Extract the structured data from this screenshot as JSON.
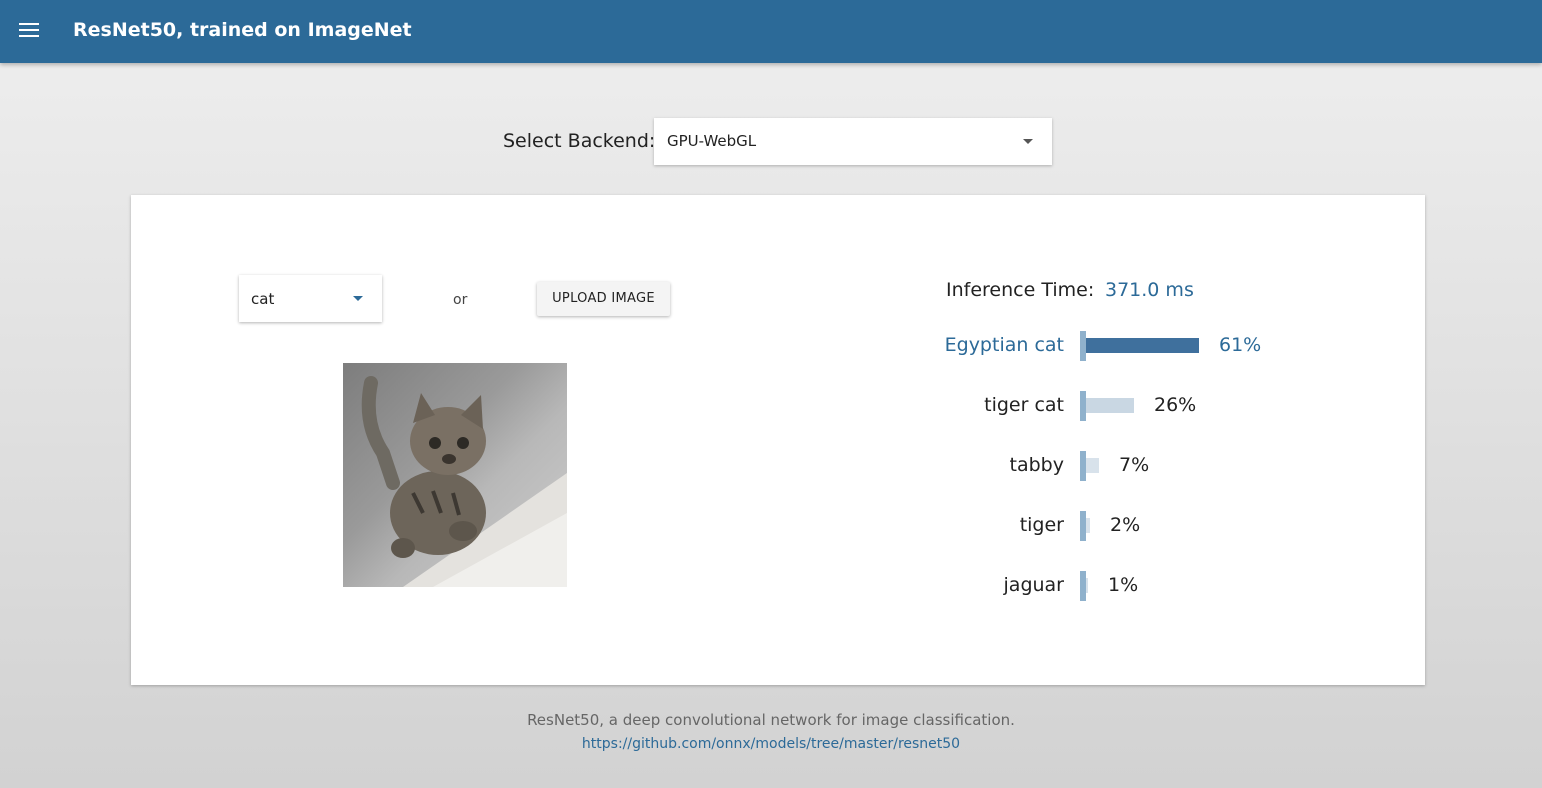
{
  "appbar": {
    "title": "ResNet50, trained on ImageNet"
  },
  "backend": {
    "label": "Select Backend:",
    "selected": "GPU-WebGL"
  },
  "input": {
    "image_select_value": "cat",
    "or_text": "or",
    "upload_label": "UPLOAD IMAGE"
  },
  "results": {
    "inference_label": "Inference Time:",
    "inference_value": "371.0 ms",
    "predictions": [
      {
        "label": "Egyptian cat",
        "percent": "61%",
        "value": 0.61
      },
      {
        "label": "tiger cat",
        "percent": "26%",
        "value": 0.26
      },
      {
        "label": "tabby",
        "percent": "7%",
        "value": 0.07
      },
      {
        "label": "tiger",
        "percent": "2%",
        "value": 0.02
      },
      {
        "label": "jaguar",
        "percent": "1%",
        "value": 0.01
      }
    ]
  },
  "footer": {
    "description": "ResNet50, a deep convolutional network for image classification.",
    "link": "https://github.com/onnx/models/tree/master/resnet50"
  },
  "colors": {
    "primary": "#2c6a98",
    "bar": "#8fb1cc"
  }
}
